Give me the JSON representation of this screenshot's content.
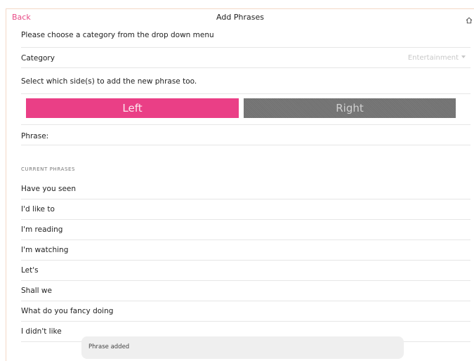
{
  "nav": {
    "back_label": "Back",
    "title": "Add Phrases",
    "home_icon": "home-icon"
  },
  "form": {
    "instruction": "Please choose a category from the drop down menu",
    "category_label": "Category",
    "category_value": "Entertainment",
    "side_instruction": "Select which side(s) to add the new phrase too.",
    "left_label": "Left",
    "right_label": "Right",
    "phrase_label": "Phrase:",
    "phrase_value": ""
  },
  "current_phrases": {
    "header": "CURRENT PHRASES",
    "items": [
      "Have you seen",
      "I'd like to",
      "I'm reading",
      "I'm watching",
      "Let's",
      "Shall we",
      "What do you fancy doing",
      "I didn't like"
    ]
  },
  "toast": {
    "message": "Phrase added"
  },
  "colors": {
    "accent": "#e84a86",
    "left_button": "#ea3f86",
    "right_button": "#7a7a7a",
    "toast_bg": "#efefef"
  }
}
